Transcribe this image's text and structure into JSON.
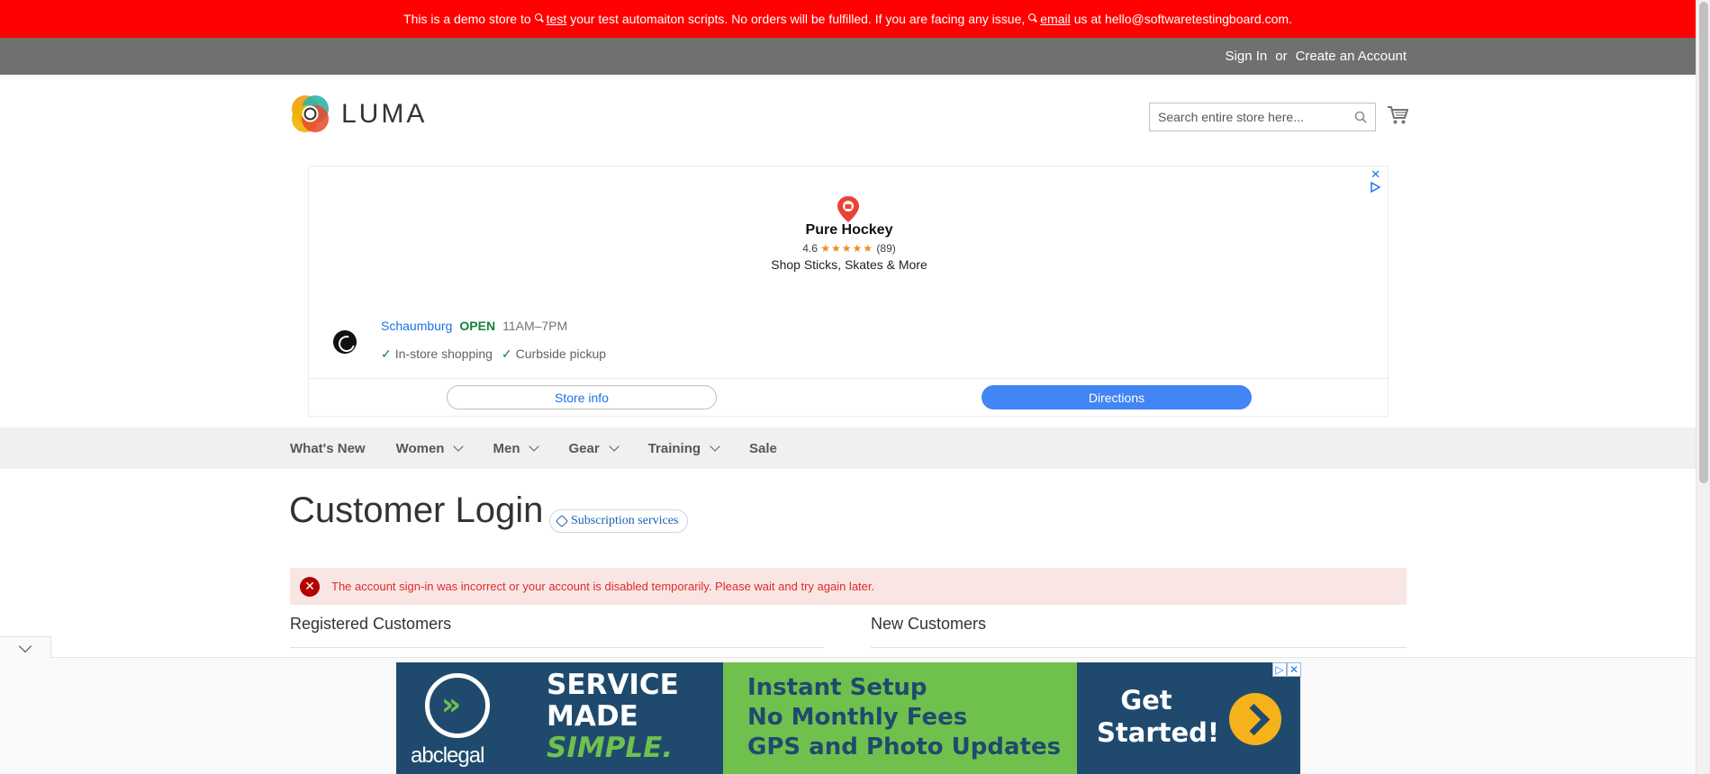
{
  "demo_banner": {
    "part1": "This is a demo store to",
    "link1": "test",
    "part2": "your test automaiton scripts. No orders will be fulfilled. If you are facing any issue,",
    "link2": "email",
    "part3": "us at hello@softwaretestingboard.com."
  },
  "header_links": {
    "sign_in": "Sign In",
    "or": "or",
    "create_account": "Create an Account"
  },
  "logo": {
    "text": "LUMA"
  },
  "search": {
    "placeholder": "Search entire store here..."
  },
  "ad": {
    "business_name": "Pure Hockey",
    "rating_value": "4.6",
    "stars": "★★★★★",
    "rating_count": "(89)",
    "tagline": "Shop Sticks, Skates & More",
    "city": "Schaumburg",
    "status": "OPEN",
    "hours": "11AM–7PM",
    "features": [
      "In-store shopping",
      "Curbside pickup"
    ],
    "store_info_label": "Store info",
    "directions_label": "Directions",
    "close_glyph": "✕",
    "adchoices_glyph": "▷"
  },
  "nav": {
    "items": [
      {
        "label": "What's New",
        "has_submenu": false
      },
      {
        "label": "Women",
        "has_submenu": true
      },
      {
        "label": "Men",
        "has_submenu": true
      },
      {
        "label": "Gear",
        "has_submenu": true
      },
      {
        "label": "Training",
        "has_submenu": true
      },
      {
        "label": "Sale",
        "has_submenu": false
      }
    ]
  },
  "page": {
    "title": "Customer Login",
    "badge": "Subscription services"
  },
  "error": {
    "message": "The account sign-in was incorrect or your account is disabled temporarily. Please wait and try again later."
  },
  "blocks": {
    "registered": "Registered Customers",
    "new": "New Customers"
  },
  "bottom_ad": {
    "brand": "abclegal",
    "line1": "SERVICE",
    "line2": "MADE",
    "line3": "SIMPLE.",
    "mid1": "Instant Setup",
    "mid2": "No Monthly Fees",
    "mid3": "GPS and Photo Updates",
    "cta1": "Get",
    "cta2": "Started!"
  },
  "colors": {
    "demo_banner": "#ff0101",
    "top_bar": "#6e716e",
    "nav_bg": "#f0f0f0",
    "error_bg": "#fae5e5",
    "error_text": "#e02b27",
    "ad_blue": "#1f4a6e",
    "ad_green": "#70c04e",
    "ad_yellow": "#f6b21b"
  },
  "icons": [
    "search-icon",
    "cart-icon",
    "luma-logo-icon",
    "map-pin-icon",
    "check-icon",
    "error-icon",
    "tag-icon",
    "chevron-down-icon",
    "close-icon",
    "adchoices-icon"
  ]
}
